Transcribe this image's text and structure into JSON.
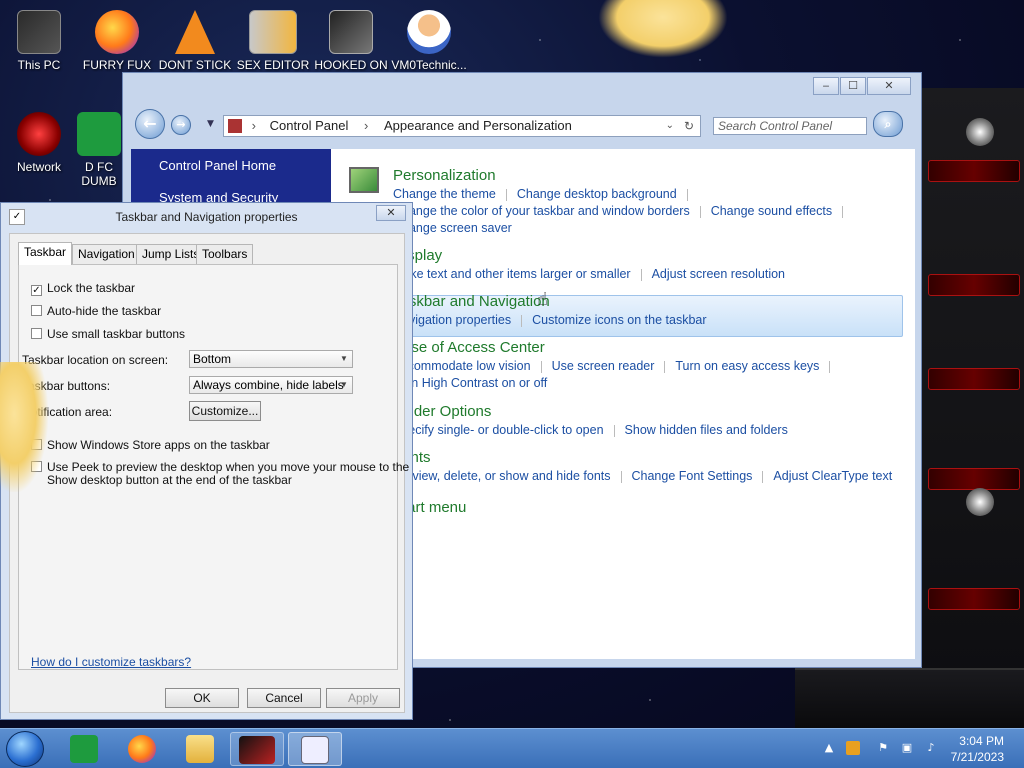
{
  "desktop": {
    "icons": [
      {
        "label": "This PC"
      },
      {
        "label": "FURRY FUX"
      },
      {
        "label": "DONT STICK"
      },
      {
        "label": "SEX EDITOR"
      },
      {
        "label": "HOOKED ON"
      },
      {
        "label": "VM0Technic..."
      },
      {
        "label": "Network"
      },
      {
        "label": "D FC DUMB"
      }
    ]
  },
  "control_panel": {
    "breadcrumb": [
      "Control Panel",
      "Appearance and Personalization"
    ],
    "search_placeholder": "Search Control Panel",
    "sidebar": [
      "Control Panel Home",
      "System and Security"
    ],
    "categories": [
      {
        "title": "Personalization",
        "links": [
          "Change the theme",
          "Change desktop background",
          "Change the color of your taskbar and window borders",
          "Change sound effects",
          "Change screen saver"
        ]
      },
      {
        "title": "Display",
        "links": [
          "Make text and other items larger or smaller",
          "Adjust screen resolution"
        ]
      },
      {
        "title": "Taskbar and Navigation",
        "links": [
          "Navigation properties",
          "Customize icons on the taskbar"
        ]
      },
      {
        "title": "Ease of Access Center",
        "links": [
          "Accommodate low vision",
          "Use screen reader",
          "Turn on easy access keys",
          "Turn High Contrast on or off"
        ]
      },
      {
        "title": "Folder Options",
        "links": [
          "Specify single- or double-click to open",
          "Show hidden files and folders"
        ]
      },
      {
        "title": "Fonts",
        "links": [
          "Preview, delete, or show and hide fonts",
          "Change Font Settings",
          "Adjust ClearType text"
        ]
      },
      {
        "title": "Start menu",
        "links": []
      }
    ]
  },
  "dialog": {
    "title": "Taskbar and Navigation properties",
    "tabs": [
      "Taskbar",
      "Navigation",
      "Jump Lists",
      "Toolbars"
    ],
    "lock_taskbar": "Lock the taskbar",
    "auto_hide": "Auto-hide the taskbar",
    "small_buttons": "Use small taskbar buttons",
    "location_label": "Taskbar location on screen:",
    "location_value": "Bottom",
    "buttons_label": "Taskbar buttons:",
    "buttons_value": "Always combine, hide labels",
    "notification_label": "Notification area:",
    "customize": "Customize...",
    "store_apps": "Show Windows Store apps on the taskbar",
    "peek_line1": "Use Peek to preview the desktop when you move your mouse to the",
    "peek_line2": "Show desktop button at the end of the taskbar",
    "help_link": "How do I customize taskbars?",
    "ok": "OK",
    "cancel": "Cancel",
    "apply": "Apply"
  },
  "taskbar": {
    "time": "3:04 PM",
    "date": "7/21/2023"
  }
}
